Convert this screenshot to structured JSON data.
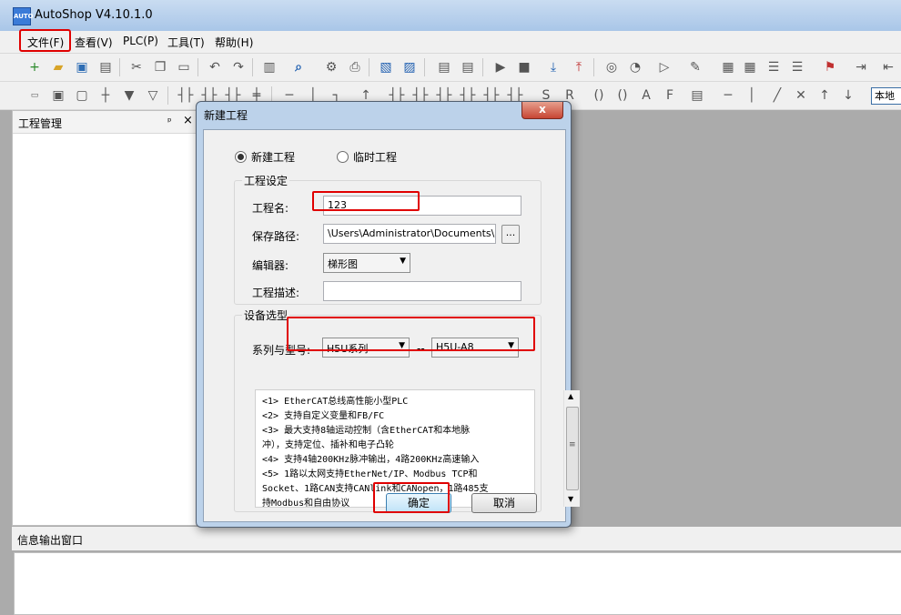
{
  "window": {
    "title": "AutoShop V4.10.1.0",
    "icon_text": "AUTO"
  },
  "menu": [
    {
      "label": "文件(F)"
    },
    {
      "label": "查看(V)"
    },
    {
      "label": "PLC(P)"
    },
    {
      "label": "工具(T)"
    },
    {
      "label": "帮助(H)"
    }
  ],
  "toolbar2": {
    "combo_text": "本地"
  },
  "project_panel": {
    "title": "工程管理",
    "pin": "ᵖ",
    "close": "×"
  },
  "info_panel": {
    "title": "信息输出窗口"
  },
  "dialog": {
    "title": "新建工程",
    "close": "x",
    "radio_new": "新建工程",
    "radio_temp": "临时工程",
    "group_project": "工程设定",
    "label_name": "工程名:",
    "value_name": "123",
    "label_path": "保存路径:",
    "value_path": "\\Users\\Administrator\\Documents\\123\\",
    "browse": "...",
    "label_editor": "编辑器:",
    "value_editor": "梯形图",
    "label_desc": "工程描述:",
    "value_desc": "",
    "group_device": "设备选型",
    "label_series": "系列与型号:",
    "value_series": "H5U系列",
    "dash": "--",
    "value_model": "H5U-A8",
    "description": [
      "<1> EtherCAT总线高性能小型PLC",
      "<2> 支持自定义变量和FB/FC",
      "<3> 最大支持8轴运动控制（含EtherCAT和本地脉",
      "冲），支持定位、插补和电子凸轮",
      "<4> 支持4轴200KHz脉冲输出，4路200KHz高速输入",
      "<5> 1路以太网支持EtherNet/IP、Modbus TCP和",
      "Socket、1路CAN支持CANlink和CANopen，1路485支",
      "持Modbus和自由协议"
    ],
    "ok": "确定",
    "cancel": "取消"
  },
  "colors": {
    "highlight": "#e00000",
    "dialog_frame": "#bcd2ea"
  }
}
